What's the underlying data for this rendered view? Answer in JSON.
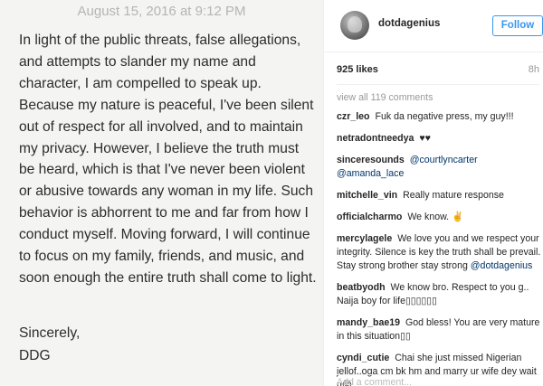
{
  "note": {
    "date": "August 15, 2016 at 9:12 PM",
    "body": "In light of the public threats, false allegations, and attempts to slander my name and character, I am compelled to speak up.  Because my nature is peaceful, I've been silent out of respect for all involved, and to maintain my privacy. However, I believe the truth must be heard, which is that I've never been violent or abusive towards any woman in my life. Such behavior is abhorrent to me and far from how I conduct myself.  Moving forward, I will continue to focus on my family, friends, and music, and soon enough the entire truth shall come to light.",
    "closing": "Sincerely,",
    "signature": "DDG"
  },
  "post": {
    "username": "dotdagenius",
    "follow_label": "Follow",
    "likes": "925 likes",
    "time_ago": "8h",
    "view_all": "view all 119 comments",
    "add_comment_placeholder": "Add a comment..."
  },
  "comments": [
    {
      "user": "czr_leo",
      "text": "Fuk da negative press, my guy!!!"
    },
    {
      "user": "netradontneedya",
      "text": "♥♥"
    },
    {
      "user": "sinceresounds",
      "text": "@courtlyncarter @amanda_lace"
    },
    {
      "user": "mitchelle_vin",
      "text": "Really mature response"
    },
    {
      "user": "officialcharmo",
      "text": "We know. ✌"
    },
    {
      "user": "mercylagele",
      "text": "We love you and we respect your integrity. Silence is key the truth shall be prevail. Stay strong brother stay strong @dotdagenius"
    },
    {
      "user": "beatbyodh",
      "text": "We know bro. Respect to you g.. Naija boy for life▯▯▯▯▯▯"
    },
    {
      "user": "mandy_bae19",
      "text": "God bless! You are very mature in this situation▯▯"
    },
    {
      "user": "cyndi_cutie",
      "text": "Chai she just missed Nigerian jellof..oga cm bk hm and marry ur wife dey wait u☹"
    }
  ],
  "colors": {
    "accent": "#3897f0",
    "mention": "#003569"
  }
}
